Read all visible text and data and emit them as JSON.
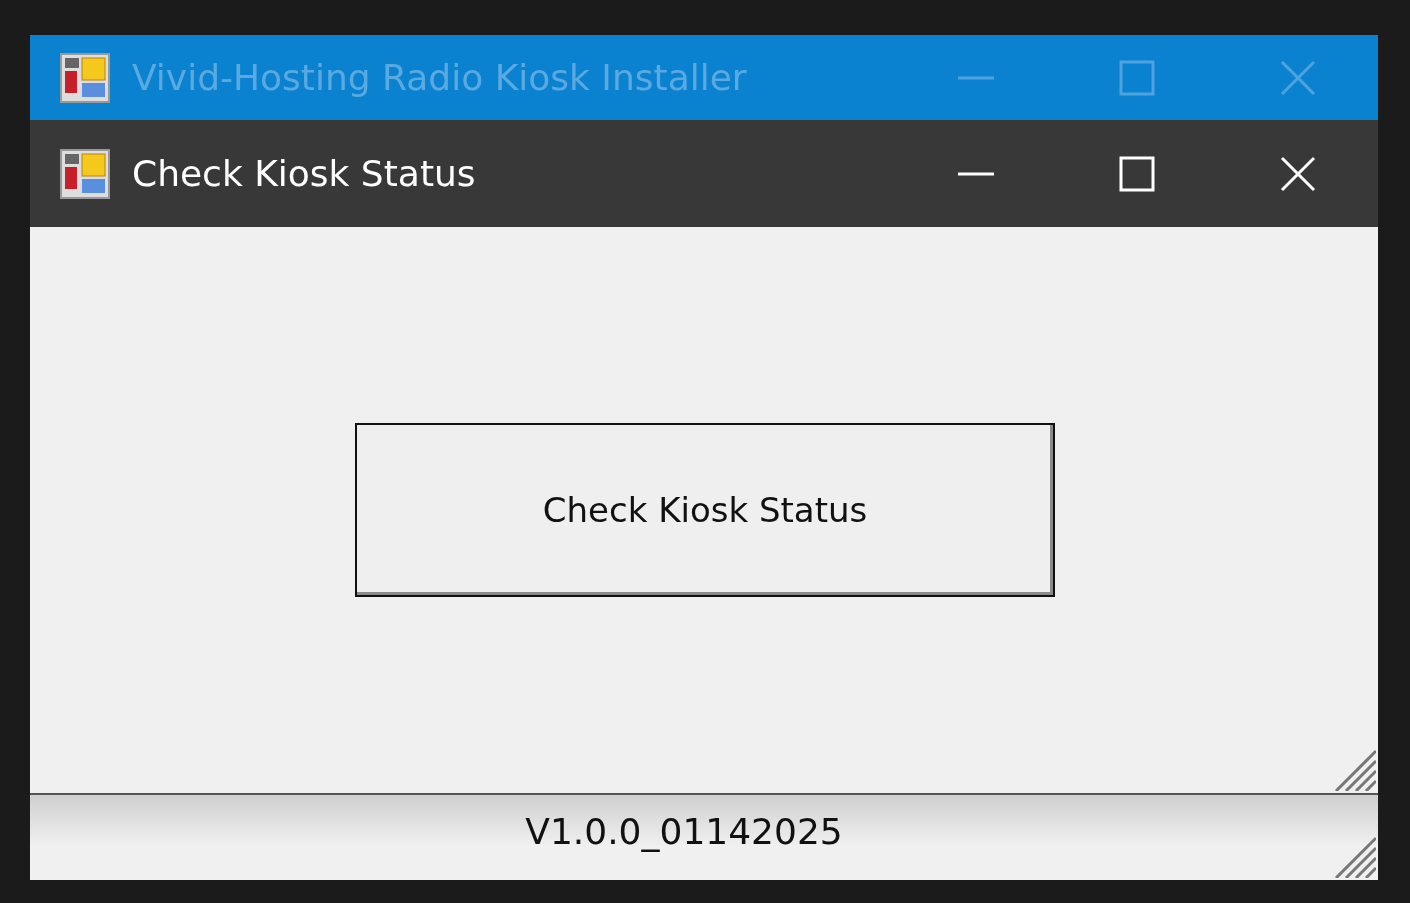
{
  "windows": [
    {
      "title": "Vivid-Hosting Radio Kiosk Installer",
      "active": false
    },
    {
      "title": "Check Kiosk Status",
      "active": true
    }
  ],
  "dialog": {
    "button": "Check Kiosk Status"
  },
  "installer": {
    "version": "V1.0.0_01142025"
  }
}
